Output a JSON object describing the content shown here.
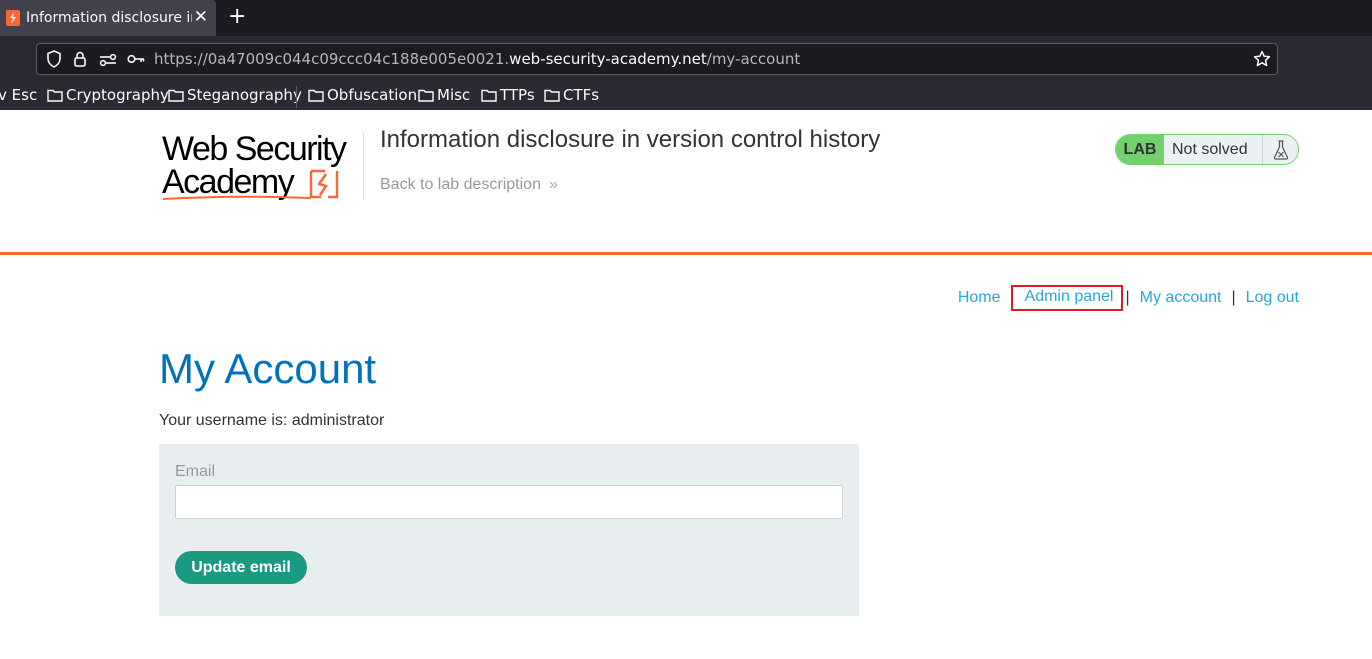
{
  "browser": {
    "tab_title": "Information disclosure in v",
    "url_prefix": "https://0a47009c044c09ccc04c188e005e0021.",
    "url_host": "web-security-academy.net",
    "url_path": "/my-account"
  },
  "bookmarks": [
    {
      "label": "v Esc"
    },
    {
      "label": "Cryptography"
    },
    {
      "label": "Steganography"
    },
    {
      "label": "Obfuscation"
    },
    {
      "label": "Misc"
    },
    {
      "label": "TTPs"
    },
    {
      "label": "CTFs"
    }
  ],
  "header": {
    "logo_line1": "Web Security",
    "logo_line2": "Academy",
    "lab_title": "Information disclosure in version control history",
    "back_link": "Back to lab description",
    "back_chevron": "»",
    "lab_badge": "LAB",
    "lab_status": "Not solved"
  },
  "nav": {
    "home": "Home",
    "admin_panel": "Admin panel",
    "my_account": "My account",
    "log_out": "Log out",
    "separator": "|"
  },
  "account": {
    "title": "My Account",
    "username_line": "Your username is: administrator",
    "email_label": "Email",
    "email_value": "",
    "update_button": "Update email"
  },
  "colors": {
    "accent_orange": "#ff6633",
    "link_blue": "#29a6dc",
    "title_blue": "#0071bc",
    "button_green": "#1a9a80",
    "lab_green": "#70d16d",
    "highlight_red": "#e01b24"
  }
}
